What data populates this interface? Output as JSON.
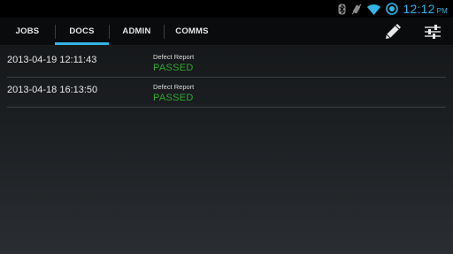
{
  "status_bar": {
    "icons": [
      "bluetooth-icon",
      "vibrate-icon",
      "wifi-icon",
      "battery-icon"
    ],
    "time": "12:12",
    "ampm": "PM",
    "accent_color": "#33b5e5"
  },
  "tabs": [
    {
      "label": "JOBS",
      "selected": false
    },
    {
      "label": "DOCS",
      "selected": true
    },
    {
      "label": "ADMIN",
      "selected": false
    },
    {
      "label": "COMMS",
      "selected": false
    }
  ],
  "actions": [
    "pencil-edit-icon",
    "settings-sliders-icon"
  ],
  "documents": [
    {
      "date": "2013-04-19 12:11:43",
      "type": "Defect Report",
      "status": "PASSED"
    },
    {
      "date": "2013-04-18 16:13:50",
      "type": "Defect Report",
      "status": "PASSED"
    }
  ],
  "colors": {
    "tab_indicator": "#33b5e5",
    "status_passed": "#2da82d"
  }
}
